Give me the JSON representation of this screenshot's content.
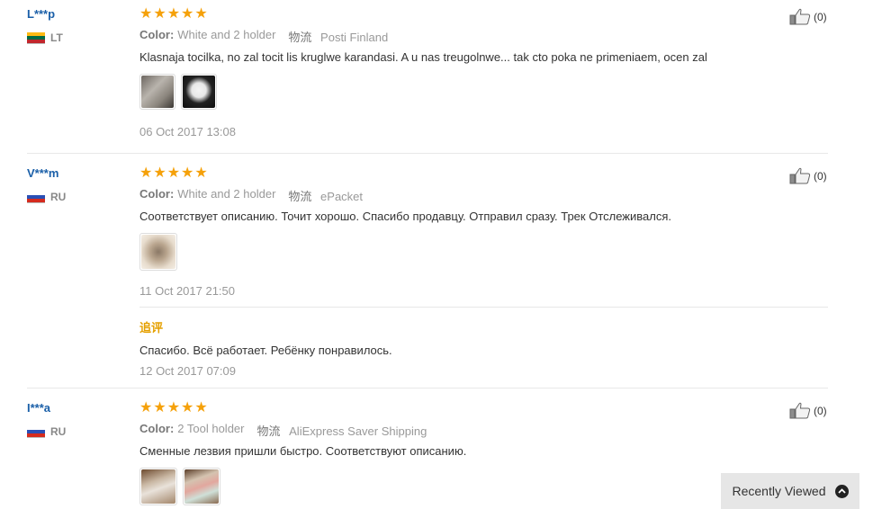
{
  "reviews": [
    {
      "user": "L***p",
      "country": "LT",
      "flag_colors": [
        "#fdb913",
        "#006a44",
        "#c1272d"
      ],
      "rating": 5,
      "color_label": "Color:",
      "color_value": "White and 2 holder",
      "shipping_label": "物流",
      "shipping_value": "Posti Finland",
      "text": "Klasnaja tocilka, no zal tocit lis kruglwe karandasi. A u nas treugolnwe... tak cto poka ne primeniaem, ocen zal",
      "images": [
        "photo-sharpener-open",
        "photo-sharpener-white"
      ],
      "date": "06 Oct 2017 13:08",
      "helpful_count": "(0)"
    },
    {
      "user": "V***m",
      "country": "RU",
      "flag_colors": [
        "#ffffff",
        "#2a4fb5",
        "#d52b1e"
      ],
      "rating": 5,
      "color_label": "Color:",
      "color_value": "White and 2 holder",
      "shipping_label": "物流",
      "shipping_value": "ePacket",
      "text": "Соответствует описанию. Точит хорошо. Спасибо продавцу. Отправил сразу. Трек Отслеживался.",
      "images": [
        "photo-sharpener-hand"
      ],
      "date": "11 Oct 2017 21:50",
      "followup": {
        "label": "追评",
        "text": "Спасибо. Всё работает. Ребёнку понравилось.",
        "date": "12 Oct 2017 07:09"
      },
      "helpful_count": "(0)"
    },
    {
      "user": "I***a",
      "country": "RU",
      "flag_colors": [
        "#ffffff",
        "#2a4fb5",
        "#d52b1e"
      ],
      "rating": 5,
      "color_label": "Color:",
      "color_value": "2 Tool holder",
      "shipping_label": "物流",
      "shipping_value": "AliExpress Saver Shipping",
      "text": "Сменные лезвия пришли быстро. Соответствуют описанию.",
      "images": [
        "photo-package-blades",
        "photo-package-holder"
      ],
      "helpful_count": "(0)"
    }
  ],
  "recently_viewed": {
    "label": "Recently Viewed"
  },
  "icons": {
    "star": "star-icon",
    "thumbs_up": "thumbs-up-icon",
    "expand": "chevron-up-icon"
  },
  "colors": {
    "star": "#f5a10a",
    "username": "#1a5fa8",
    "followup": "#e5a000"
  }
}
